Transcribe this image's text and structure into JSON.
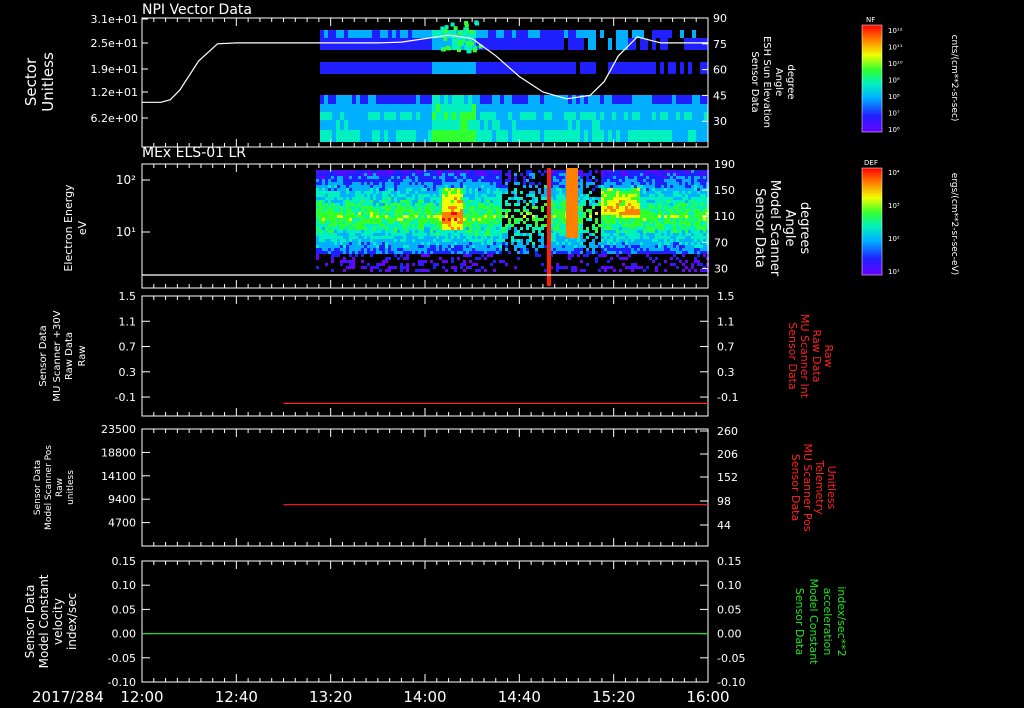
{
  "chart_data": [
    {
      "type": "heatmap",
      "title": "NPI Vector Data",
      "ylabel": [
        "Sector",
        "Unitless"
      ],
      "y_ticks": [
        "3.1e+01",
        "2.5e+01",
        "1.9e+01",
        "1.2e+01",
        "6.2e+00"
      ],
      "right_label": [
        "Sensor Data",
        "ESH Sun Elevation",
        "Angle",
        "degree"
      ],
      "right_ticks": [
        "90",
        "75",
        "60",
        "45",
        "30"
      ],
      "right_range": [
        15,
        90
      ],
      "colorbar_title": "NF",
      "colorbar_ticks": [
        "10¹²",
        "10¹¹",
        "10¹⁰",
        "10⁹",
        "10⁸",
        "10⁷",
        "10⁶"
      ],
      "colorbar_unit": "cnts/(cm**2-sr-sec)",
      "elevation_curve": {
        "x": [
          "12:00",
          "12:08",
          "12:12",
          "12:16",
          "12:24",
          "12:32",
          "12:40",
          "13:00",
          "13:20",
          "13:40",
          "13:50",
          "14:00",
          "14:10",
          "14:20",
          "14:30",
          "14:40",
          "14:50",
          "15:00",
          "15:10",
          "15:16",
          "15:22",
          "15:30",
          "15:40",
          "15:50",
          "16:00"
        ],
        "y": [
          41,
          41,
          42.5,
          48,
          65,
          75,
          75.5,
          75.5,
          75.5,
          75.5,
          76,
          78,
          80,
          78,
          68,
          56,
          47,
          43,
          45,
          53,
          68,
          79,
          75.5,
          75.5,
          75.5
        ]
      }
    },
    {
      "type": "heatmap",
      "title": "MEx ELS-01 LR",
      "ylabel": [
        "Electron Energy",
        "eV"
      ],
      "y_ticks": [
        "10²",
        "10¹"
      ],
      "right_label": [
        "Sensor Data",
        "Model Scanner",
        "Angle",
        "degrees"
      ],
      "right_ticks": [
        "190",
        "150",
        "110",
        "70",
        "30"
      ],
      "right_range": [
        0,
        190
      ],
      "colorbar_title": "DEF",
      "colorbar_ticks": [
        "10⁴",
        "10³",
        "10²",
        "10¹"
      ],
      "colorbar_unit": "ergs/(cm**2-sr-sec-eV)",
      "scanner_angle": {
        "x": [
          "12:00",
          "16:00"
        ],
        "y": [
          10,
          10
        ]
      }
    },
    {
      "type": "line",
      "left_label": [
        "Sensor Data",
        "MU Scanner +30V",
        "Raw Data",
        "Raw"
      ],
      "left_ticks": [
        "1.5",
        "1.1",
        "0.7",
        "0.3",
        "-0.1"
      ],
      "right_label": [
        "Sensor Data",
        "MU Scanner Int",
        "Raw Data",
        "Raw"
      ],
      "right_ticks": [
        "1.5",
        "1.1",
        "0.7",
        "0.3",
        "-0.1"
      ],
      "ylim": [
        -0.4,
        1.5
      ],
      "series": [
        {
          "x": [
            "13:00",
            "16:00"
          ],
          "y": [
            -0.2,
            -0.2
          ],
          "color": "#ff2020"
        }
      ]
    },
    {
      "type": "line",
      "left_label": [
        "Sensor Data",
        "Model Scanner Pos",
        "Raw",
        "unitless"
      ],
      "left_ticks": [
        "23500",
        "18800",
        "14100",
        "9400",
        "4700"
      ],
      "right_label": [
        "Sensor Data",
        "MU Scanner Pos",
        "Telemetry",
        "Unitless"
      ],
      "right_ticks": [
        "260",
        "206",
        "152",
        "98",
        "44"
      ],
      "ylim": [
        0,
        23500
      ],
      "series": [
        {
          "x": [
            "13:00",
            "16:00"
          ],
          "y": [
            8300,
            8300
          ],
          "color": "#ff2020"
        }
      ]
    },
    {
      "type": "line",
      "left_label": [
        "Sensor Data",
        "Model Constant",
        "velocity",
        "index/sec"
      ],
      "left_ticks": [
        "0.15",
        "0.10",
        "0.05",
        "0.00",
        "-0.05",
        "-0.10"
      ],
      "right_label": [
        "Sensor Data",
        "Model Constant",
        "acceleration",
        "index/sec**2"
      ],
      "right_ticks": [
        "0.15",
        "0.10",
        "0.05",
        "0.00",
        "-0.05",
        "-0.10"
      ],
      "ylim": [
        -0.1,
        0.15
      ],
      "series": [
        {
          "x": [
            "12:00",
            "16:00"
          ],
          "y": [
            0,
            0
          ],
          "color": "#20e020"
        }
      ]
    }
  ],
  "x_axis": {
    "date": "2017/284",
    "ticks": [
      "12:00",
      "12:40",
      "13:20",
      "14:00",
      "14:40",
      "15:20",
      "16:00"
    ]
  },
  "colors": {
    "background": "#000000",
    "axes": "#ffffff",
    "red_label": "#ff2020",
    "green_label": "#20e020"
  }
}
